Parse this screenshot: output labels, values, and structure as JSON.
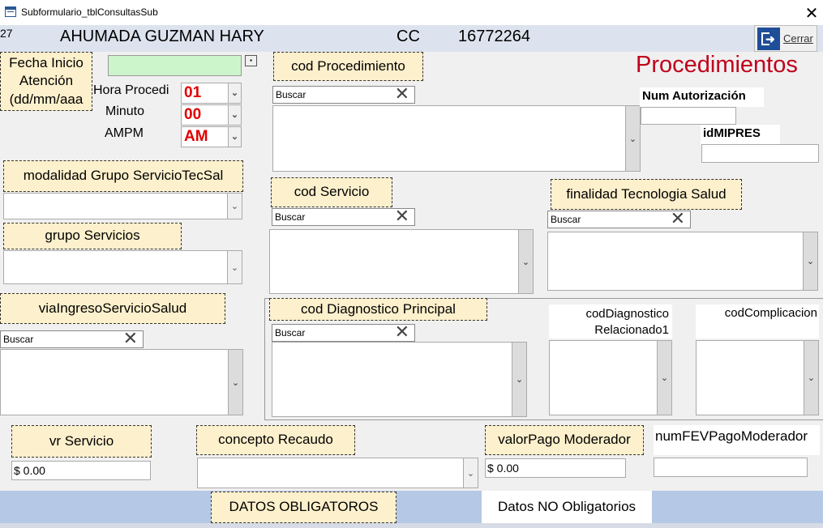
{
  "window": {
    "title": "Subformulario_tblConsultasSub",
    "close_label": "✕"
  },
  "header": {
    "num": "27",
    "name": "AHUMADA GUZMAN HARY",
    "doc_type": "CC",
    "doc_number": "16772264",
    "cerrar_label": "Cerrar"
  },
  "fecha": {
    "label": "Fecha Inicio Atención (dd/mm/aaa",
    "value": ""
  },
  "hora": {
    "label": "Hora Procedi",
    "value": "01"
  },
  "minuto": {
    "label": "Minuto",
    "value": "00"
  },
  "ampm": {
    "label": "AMPM",
    "value": "AM"
  },
  "cod_procedimiento": {
    "label": "cod Procedimiento",
    "search_placeholder": "Buscar"
  },
  "title": "Procedimientos",
  "num_autorizacion": {
    "label": "Num Autorización",
    "value": ""
  },
  "idmipres": {
    "label": "idMIPRES",
    "value": ""
  },
  "modalidad": {
    "label": "modalidad Grupo ServicioTecSal",
    "value": ""
  },
  "grupo_servicios": {
    "label": "grupo Servicios",
    "value": ""
  },
  "cod_servicio": {
    "label": "cod Servicio",
    "search_placeholder": "Buscar"
  },
  "finalidad": {
    "label": "finalidad Tecnologia Salud",
    "search_placeholder": "Buscar"
  },
  "via_ingreso": {
    "label": "viaIngresoServicioSalud",
    "search_placeholder": "Buscar"
  },
  "cod_diagnostico": {
    "label": "cod Diagnostico Principal",
    "search_placeholder": "Buscar"
  },
  "cod_diag_rel": {
    "label": "codDiagnostico Relacionado1"
  },
  "cod_complicacion": {
    "label": "codComplicacion"
  },
  "vr_servicio": {
    "label": "vr Servicio",
    "value": "$ 0.00"
  },
  "concepto_recaudo": {
    "label": "concepto Recaudo",
    "value": ""
  },
  "valor_pago": {
    "label": "valorPago Moderador",
    "value": "$ 0.00"
  },
  "num_fev": {
    "label": "numFEVPagoModerador",
    "value": ""
  },
  "footer": {
    "datos_obligatorios": "DATOS OBLIGATOROS",
    "datos_no_obligatorios": "Datos NO Obligatorios"
  },
  "colors": {
    "accent_red": "#c0001a",
    "label_bg": "#fdf0cc",
    "footer_bg": "#b5c8e5"
  }
}
